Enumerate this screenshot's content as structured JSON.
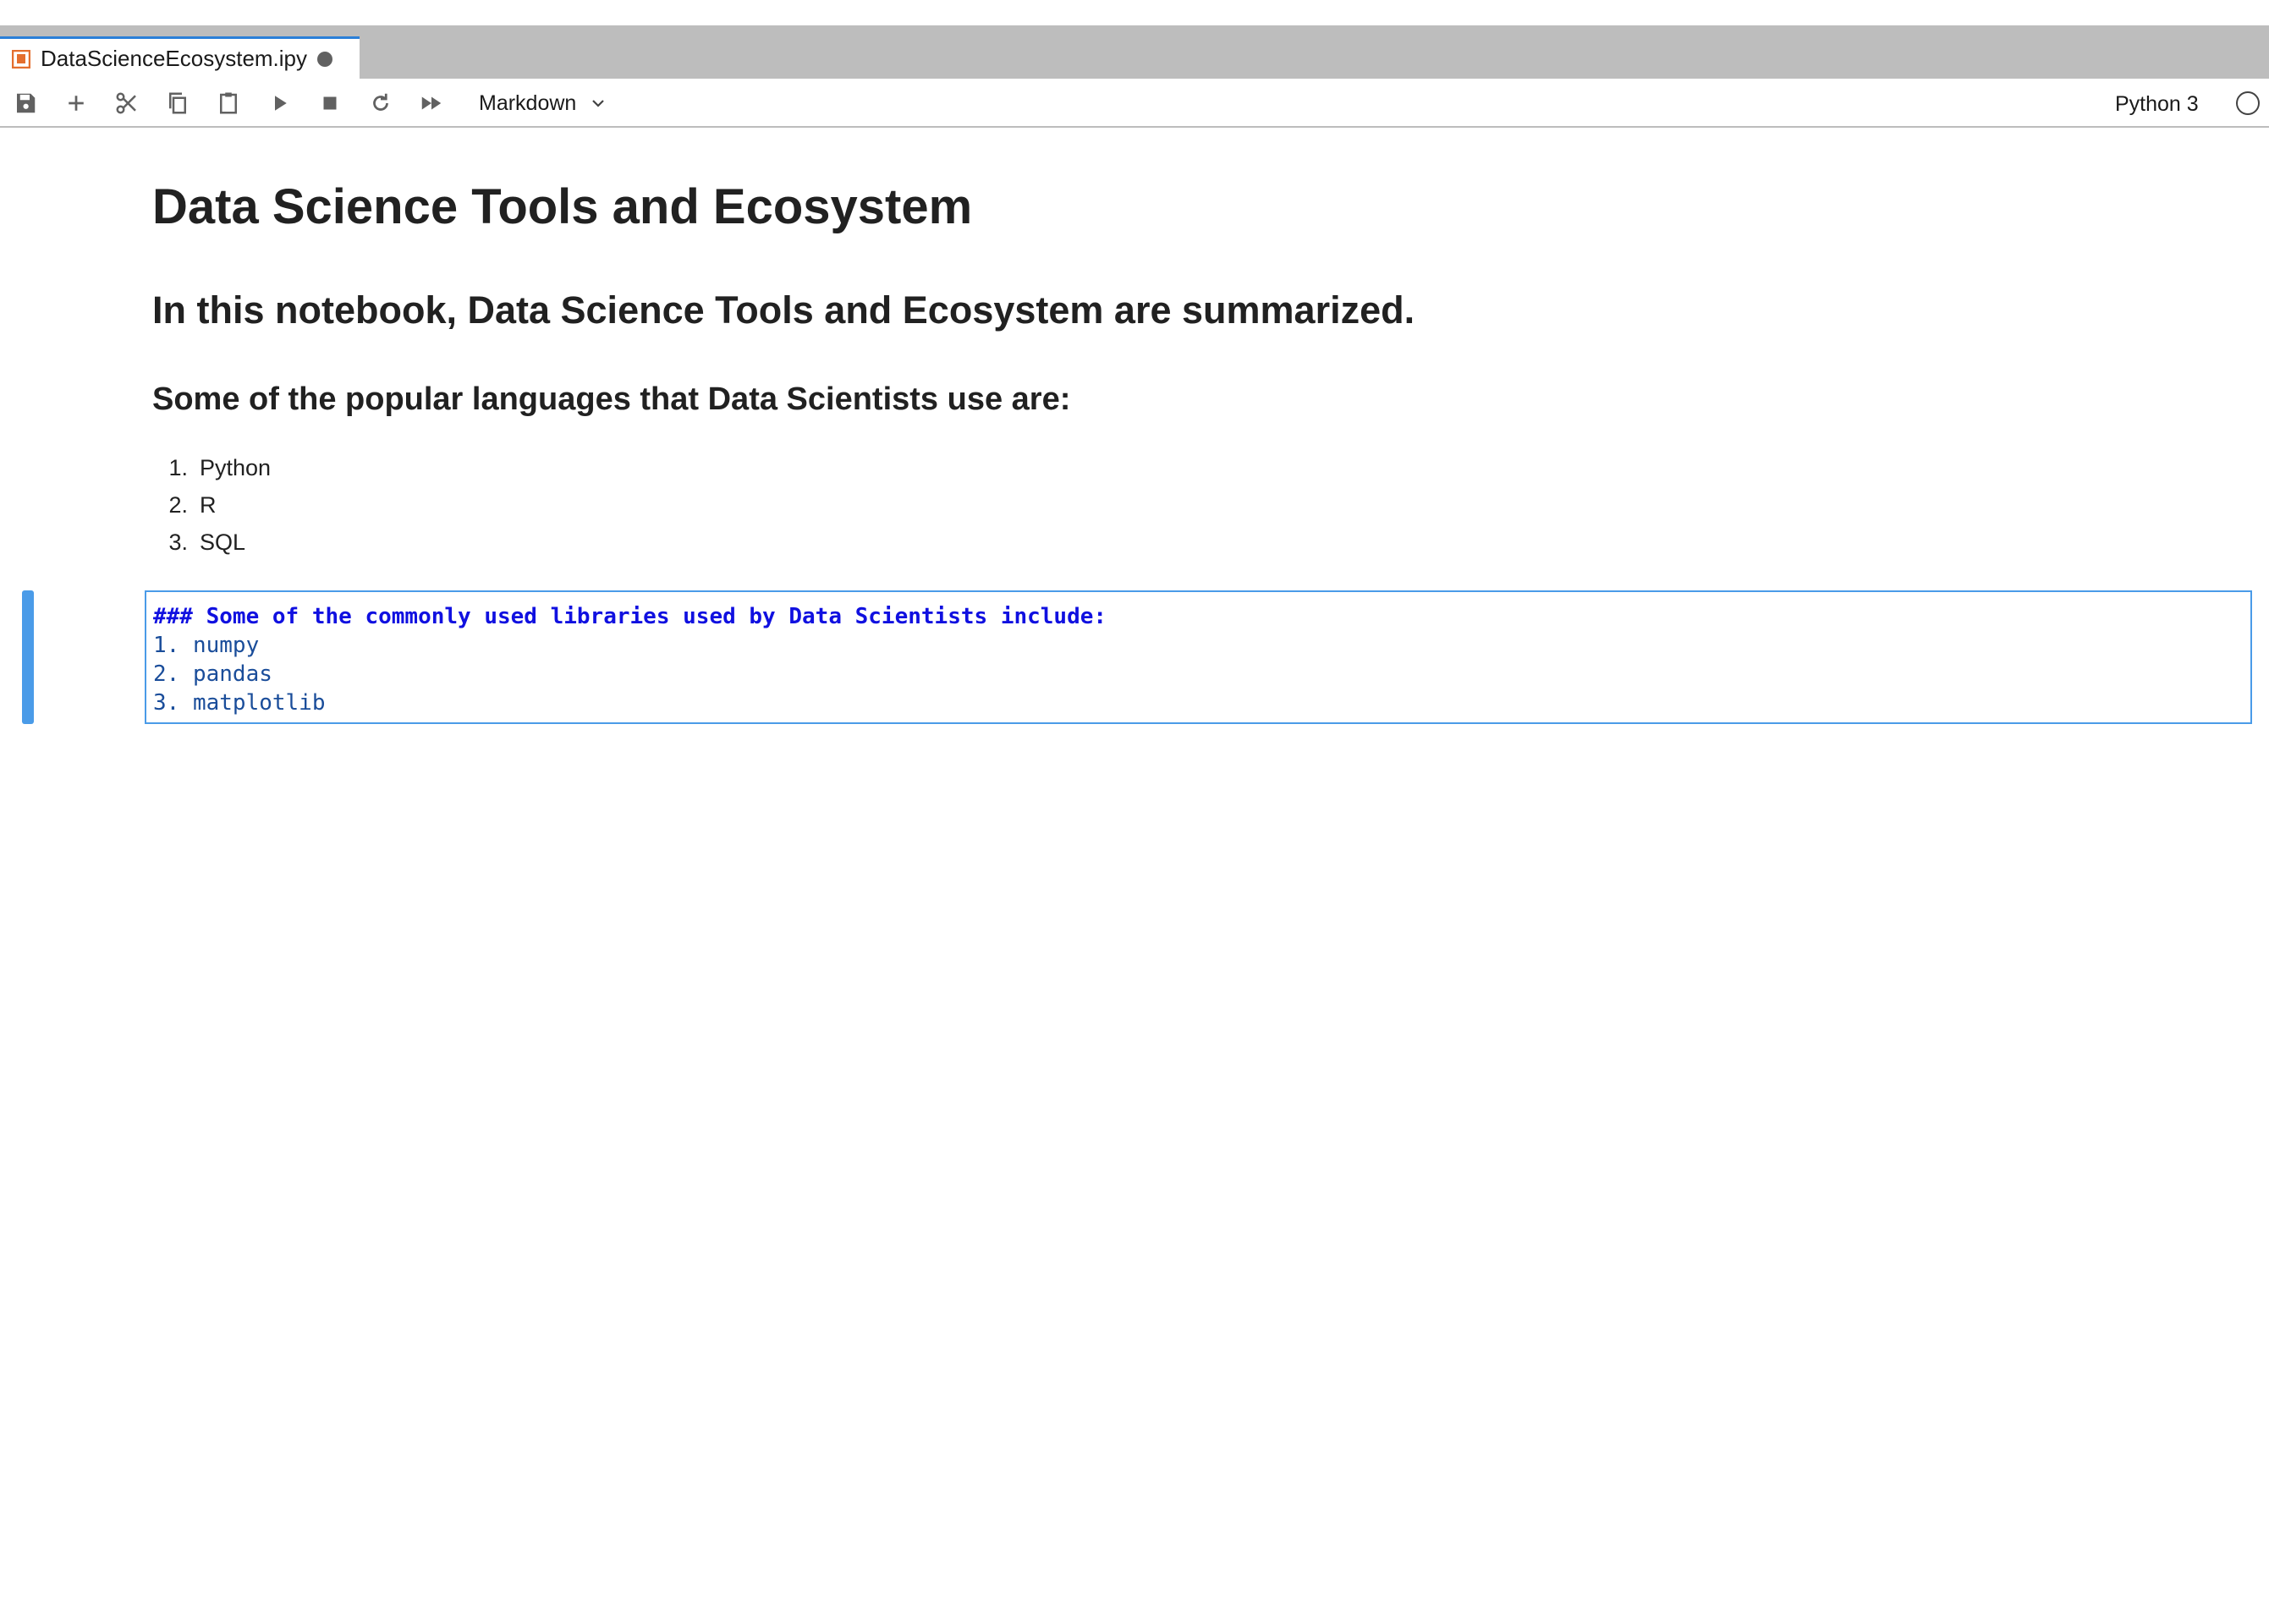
{
  "tab": {
    "title": "DataScienceEcosystem.ipy",
    "icon": "notebook-icon",
    "unsaved": true
  },
  "toolbar": {
    "buttons": [
      "save-icon",
      "add-icon",
      "cut-icon",
      "copy-icon",
      "paste-icon",
      "run-icon",
      "stop-icon",
      "restart-icon",
      "fast-forward-icon"
    ],
    "cell_type": "Markdown",
    "kernel_name": "Python 3",
    "kernel_status": "idle"
  },
  "notebook": {
    "title": "Data Science Tools and Ecosystem",
    "intro": "In this notebook, Data Science Tools and Ecosystem are summarized.",
    "languages_heading": "Some of the popular languages that Data Scientists use are:",
    "languages": [
      {
        "num": "1.",
        "text": "Python"
      },
      {
        "num": "2.",
        "text": "R"
      },
      {
        "num": "3.",
        "text": "SQL"
      }
    ],
    "editor": {
      "heading_line": "### Some of the commonly used libraries used by Data Scientists include:",
      "list_lines": [
        "1. numpy",
        "2. pandas",
        "3. matplotlib"
      ]
    }
  },
  "colors": {
    "accent": "#4a9be8",
    "tab_bar": "#bdbdbd",
    "code_heading": "#1010e0",
    "code_list": "#1a4d9a"
  }
}
